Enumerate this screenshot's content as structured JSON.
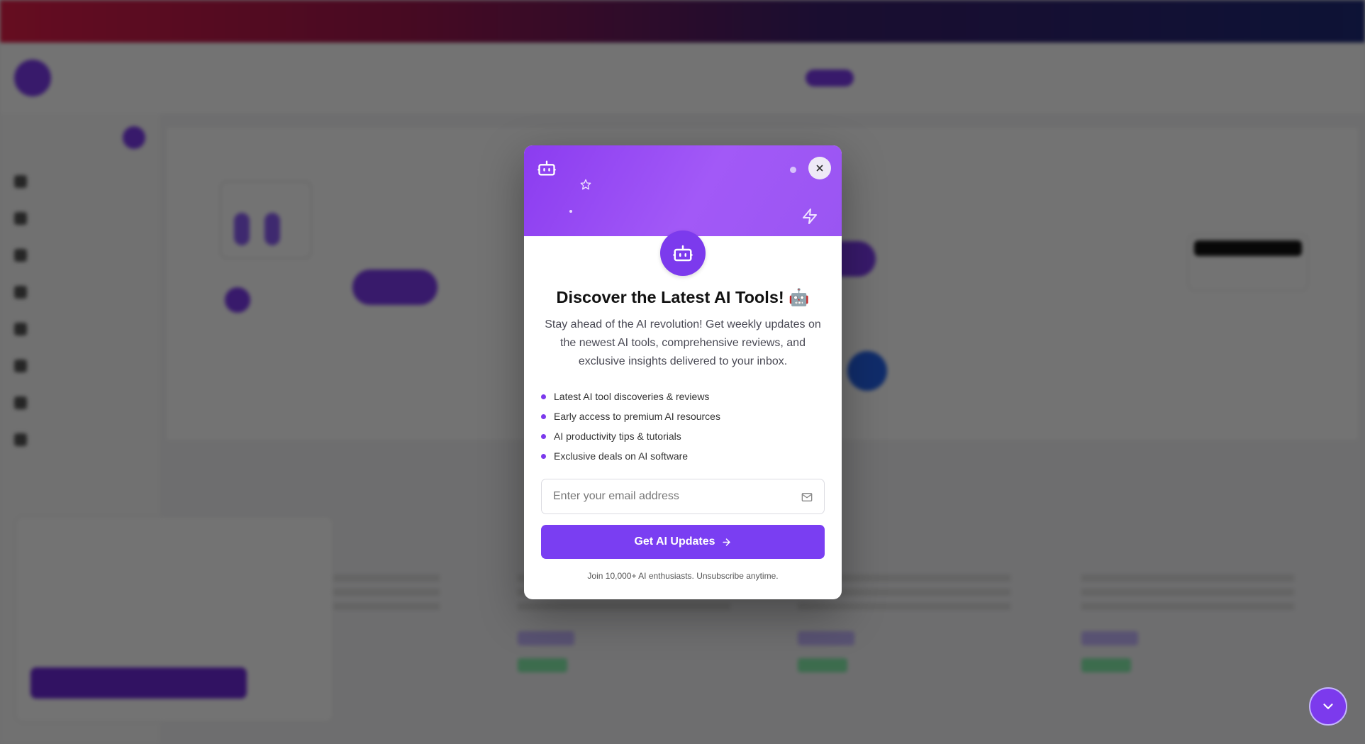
{
  "background": {
    "promo_text": "",
    "logo_text": "",
    "nav": [],
    "sidebar_title": "",
    "featured_title": "",
    "cookie": {
      "title": "",
      "text": "",
      "link": "",
      "accept": "",
      "reject": ""
    }
  },
  "modal": {
    "title": "Discover the Latest AI Tools! 🤖",
    "description": "Stay ahead of the AI revolution! Get weekly updates on the newest AI tools, comprehensive reviews, and exclusive insights delivered to your inbox.",
    "features": [
      "Latest AI tool discoveries & reviews",
      "Early access to premium AI resources",
      "AI productivity tips & tutorials",
      "Exclusive deals on AI software"
    ],
    "email_placeholder": "Enter your email address",
    "submit_label": "Get AI Updates",
    "footnote": "Join 10,000+ AI enthusiasts. Unsubscribe anytime.",
    "icons": {
      "close": "close-icon",
      "header_bot": "robot-icon",
      "star": "star-icon",
      "zap": "zap-icon",
      "center_bot": "robot-icon",
      "mail": "mail-icon",
      "arrow": "arrow-right-icon"
    }
  },
  "colors": {
    "accent": "#7c3aed",
    "modal_header": "#9a55f2",
    "overlay": "rgba(0,0,0,0.55)"
  }
}
